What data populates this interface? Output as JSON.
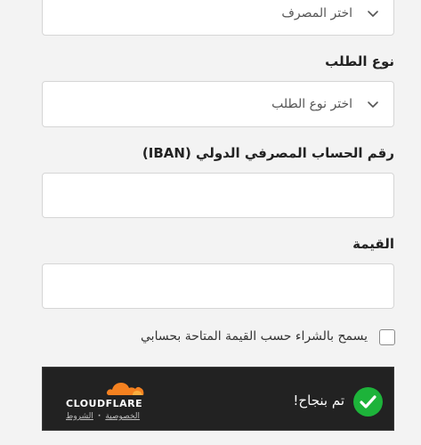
{
  "form": {
    "bank_select": {
      "value": "اختر المصرف"
    },
    "request_type": {
      "label": "نوع الطلب",
      "value": "اختر نوع الطلب"
    },
    "iban": {
      "label": "رقم الحساب المصرفي الدولي (IBAN)",
      "value": ""
    },
    "amount": {
      "label": "القيمة",
      "value": ""
    },
    "purchase_checkbox": {
      "label": "يسمح بالشراء حسب القيمة المتاحة بحسابي",
      "checked": false
    }
  },
  "cloudflare_widget": {
    "status_text": "تم بنجاح!",
    "brand": "CLOUDFLARE",
    "privacy_link": "الخصوصية",
    "separator": "·",
    "terms_link": "الشروط",
    "icons": {
      "status": "check-circle-icon",
      "logo": "cloudflare-cloud-icon"
    },
    "colors": {
      "success": "#1db33a",
      "cloud": "#f48120",
      "background": "#222222"
    }
  }
}
